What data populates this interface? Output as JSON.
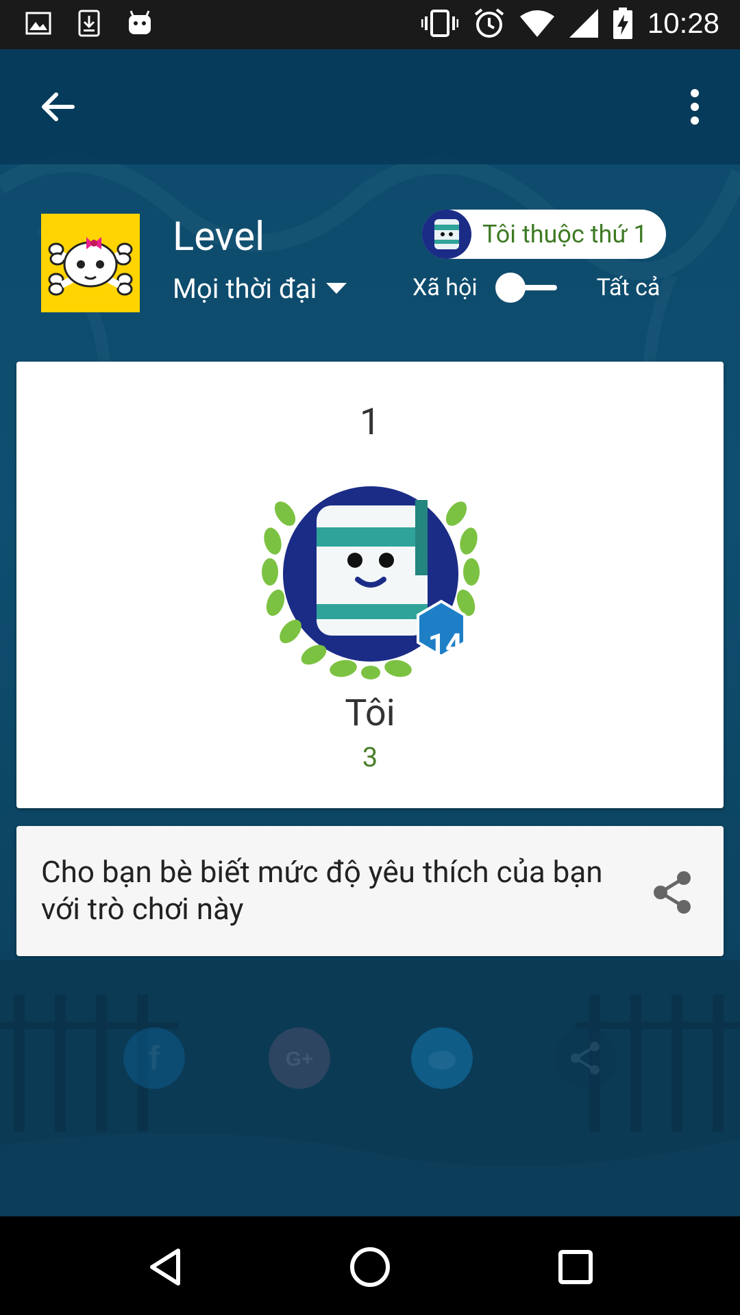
{
  "status_bar": {
    "time": "10:28",
    "left_icons": [
      "image-icon",
      "download-icon",
      "android-icon"
    ],
    "right_icons": [
      "vibrate-icon",
      "alarm-icon",
      "wifi-icon",
      "signal-icon",
      "battery-charging-icon"
    ]
  },
  "appbar": {
    "back_icon": "arrow-back-icon",
    "menu_icon": "more-vert-icon"
  },
  "leaderboard": {
    "title": "Level",
    "timeframe": "Mọi thời đại",
    "rank_pill": "Tôi thuộc thứ 1",
    "toggle_left_label": "Xã hội",
    "toggle_right_label": "Tất cả",
    "toggle_state": "Xã hội"
  },
  "entry": {
    "rank": "1",
    "player_level": "14",
    "player_name": "Tôi",
    "score": "3"
  },
  "share_card": {
    "text": "Cho bạn bè biết mức độ yêu thích của bạn với trò chơi này",
    "share_icon": "share-icon"
  },
  "nav_bar": [
    "back-triangle-icon",
    "home-circle-icon",
    "recents-square-icon"
  ],
  "colors": {
    "pill_text": "#3e7a24",
    "score_text": "#4a7f2a",
    "level_badge": "#1e7fc6",
    "game_icon_bg": "#ffd400"
  }
}
